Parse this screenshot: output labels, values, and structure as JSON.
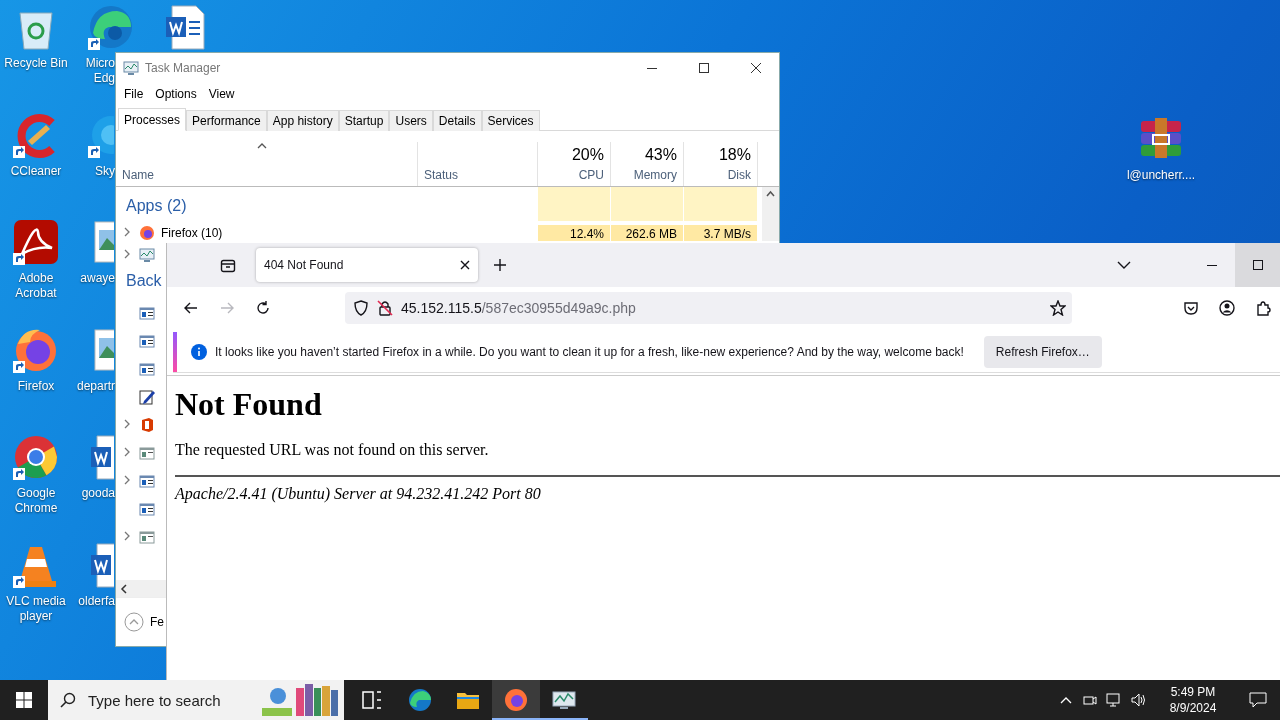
{
  "desktop_columns": [
    [
      {
        "label": "Recycle Bin",
        "kind": "recycle",
        "shortcut": false
      },
      {
        "label": "CCleaner",
        "kind": "ccleaner",
        "shortcut": true
      },
      {
        "label": "Adobe Acrobat",
        "kind": "acrobat",
        "shortcut": true
      },
      {
        "label": "Firefox",
        "kind": "firefox",
        "shortcut": true
      },
      {
        "label": "Google Chrome",
        "kind": "chrome",
        "shortcut": true
      },
      {
        "label": "VLC media player",
        "kind": "vlc",
        "shortcut": true
      }
    ],
    [
      {
        "label": "Micro Edg",
        "kind": "edge",
        "shortcut": true
      },
      {
        "label": "Sky",
        "kind": "skype",
        "shortcut": true
      },
      {
        "label": "awaye",
        "kind": "image",
        "shortcut": false
      },
      {
        "label": "departr",
        "kind": "image",
        "shortcut": false
      },
      {
        "label": "gooda",
        "kind": "word",
        "shortcut": false
      },
      {
        "label": "olderfa",
        "kind": "word",
        "shortcut": false
      }
    ],
    [
      {
        "kind": "word",
        "shortcut": false
      }
    ]
  ],
  "desktop_right": [
    {
      "label": "l@uncherr....",
      "kind": "winrar",
      "shortcut": false
    }
  ],
  "task_manager": {
    "title": "Task Manager",
    "menu": [
      "File",
      "Options",
      "View"
    ],
    "tabs": [
      {
        "label": "Processes",
        "selected": true
      },
      {
        "label": "Performance",
        "selected": false
      },
      {
        "label": "App history",
        "selected": false
      },
      {
        "label": "Startup",
        "selected": false
      },
      {
        "label": "Users",
        "selected": false
      },
      {
        "label": "Details",
        "selected": false
      },
      {
        "label": "Services",
        "selected": false
      }
    ],
    "columns": [
      {
        "label": "Name"
      },
      {
        "label": "Status"
      },
      {
        "percent": "20%",
        "label": "CPU"
      },
      {
        "percent": "43%",
        "label": "Memory"
      },
      {
        "percent": "18%",
        "label": "Disk"
      }
    ],
    "apps_heading": "Apps (2)",
    "app_rows": [
      {
        "name": "Firefox (10)",
        "kind": "firefox",
        "expandable": true,
        "cpu": "12.4%",
        "memory": "262.6 MB",
        "disk": "3.7 MB/s"
      },
      {
        "kind": "taskmgr",
        "expandable": true
      }
    ],
    "background_heading": "Back",
    "background_rows": [
      {
        "kind": "app",
        "expandable": false
      },
      {
        "kind": "app",
        "expandable": false
      },
      {
        "kind": "app",
        "expandable": false
      },
      {
        "kind": "notepad",
        "expandable": false
      },
      {
        "kind": "office",
        "expandable": true
      },
      {
        "kind": "app-gray",
        "expandable": true
      },
      {
        "kind": "app",
        "expandable": true
      },
      {
        "kind": "app",
        "expandable": false
      },
      {
        "kind": "app-gray",
        "expandable": true
      }
    ],
    "footer": "Fe"
  },
  "firefox": {
    "tabs": [
      {
        "title": "404 Not Found",
        "selected": true
      }
    ],
    "nav": [
      {
        "kind": "back",
        "disabled": false
      },
      {
        "kind": "forward",
        "disabled": true
      },
      {
        "kind": "reload",
        "disabled": false
      }
    ],
    "url": {
      "host": "45.152.115.5",
      "path": "/587ec30955d49a9c.php"
    },
    "notification": {
      "message": "It looks like you haven’t started Firefox in a while. Do you want to clean it up for a fresh, like-new experience? And by the way, welcome back!",
      "button": "Refresh Firefox…"
    },
    "page": {
      "heading": "Not Found",
      "text": "The requested URL was not found on this server.",
      "address": "Apache/2.4.41 (Ubuntu) Server at 94.232.41.242 Port 80"
    }
  },
  "taskbar": {
    "search_placeholder": "Type here to search",
    "apps": [
      {
        "kind": "taskview",
        "active": false,
        "running": false
      },
      {
        "kind": "edge",
        "active": false,
        "running": false
      },
      {
        "kind": "explorer",
        "active": false,
        "running": false
      },
      {
        "kind": "firefox",
        "active": true,
        "running": true
      },
      {
        "kind": "taskmgr",
        "active": false,
        "running": true
      }
    ],
    "time": "5:49 PM",
    "date": "8/9/2024"
  }
}
